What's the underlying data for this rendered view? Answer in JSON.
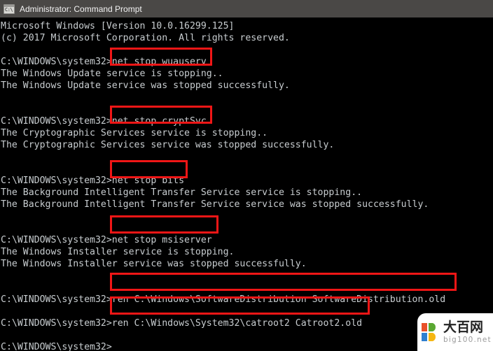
{
  "window": {
    "title": "Administrator: Command Prompt",
    "icon": "command-prompt-icon",
    "icon_glyph": "C:\\",
    "titlebar_color": "#4a4846",
    "background_color": "#000000",
    "text_color": "#c8cdd0",
    "highlight_color": "#f01616"
  },
  "console": {
    "prompt": "C:\\WINDOWS\\system32>",
    "lines": [
      {
        "id": "l0",
        "text": "Microsoft Windows [Version 10.0.16299.125]"
      },
      {
        "id": "l1",
        "text": "(c) 2017 Microsoft Corporation. All rights reserved."
      },
      {
        "id": "l2",
        "text": ""
      },
      {
        "id": "l3",
        "text": "C:\\WINDOWS\\system32>net stop wuauserv"
      },
      {
        "id": "l4",
        "text": "The Windows Update service is stopping.."
      },
      {
        "id": "l5",
        "text": "The Windows Update service was stopped successfully."
      },
      {
        "id": "l6",
        "text": ""
      },
      {
        "id": "l7",
        "text": ""
      },
      {
        "id": "l8",
        "text": "C:\\WINDOWS\\system32>net stop cryptSvc"
      },
      {
        "id": "l9",
        "text": "The Cryptographic Services service is stopping.."
      },
      {
        "id": "l10",
        "text": "The Cryptographic Services service was stopped successfully."
      },
      {
        "id": "l11",
        "text": ""
      },
      {
        "id": "l12",
        "text": ""
      },
      {
        "id": "l13",
        "text": "C:\\WINDOWS\\system32>net stop bits"
      },
      {
        "id": "l14",
        "text": "The Background Intelligent Transfer Service service is stopping.."
      },
      {
        "id": "l15",
        "text": "The Background Intelligent Transfer Service service was stopped successfully."
      },
      {
        "id": "l16",
        "text": ""
      },
      {
        "id": "l17",
        "text": ""
      },
      {
        "id": "l18",
        "text": "C:\\WINDOWS\\system32>net stop msiserver"
      },
      {
        "id": "l19",
        "text": "The Windows Installer service is stopping."
      },
      {
        "id": "l20",
        "text": "The Windows Installer service was stopped successfully."
      },
      {
        "id": "l21",
        "text": ""
      },
      {
        "id": "l22",
        "text": ""
      },
      {
        "id": "l23",
        "text": "C:\\WINDOWS\\system32>ren C:\\Windows\\SoftwareDistribution SoftwareDistribution.old"
      },
      {
        "id": "l24",
        "text": ""
      },
      {
        "id": "l25",
        "text": "C:\\WINDOWS\\system32>ren C:\\Windows\\System32\\catroot2 Catroot2.old"
      },
      {
        "id": "l26",
        "text": ""
      },
      {
        "id": "l27",
        "text": "C:\\WINDOWS\\system32>"
      }
    ],
    "highlights": [
      {
        "id": "hl-wuauserv",
        "command": "net stop wuauserv"
      },
      {
        "id": "hl-cryptsvc",
        "command": "net stop cryptSvc"
      },
      {
        "id": "hl-bits",
        "command": "net stop bits"
      },
      {
        "id": "hl-msiserver",
        "command": "net stop msiserver"
      },
      {
        "id": "hl-ren-softwaredist",
        "command": "ren C:\\Windows\\SoftwareDistribution SoftwareDistribution.old"
      },
      {
        "id": "hl-ren-catroot2",
        "command": "ren C:\\Windows\\System32\\catroot2 Catroot2.old"
      }
    ]
  },
  "watermark": {
    "chinese": "大百网",
    "domain": "big100.net",
    "logo_colors": [
      "#e8502a",
      "#5aa832",
      "#2f7fd0",
      "#f5b612"
    ]
  }
}
